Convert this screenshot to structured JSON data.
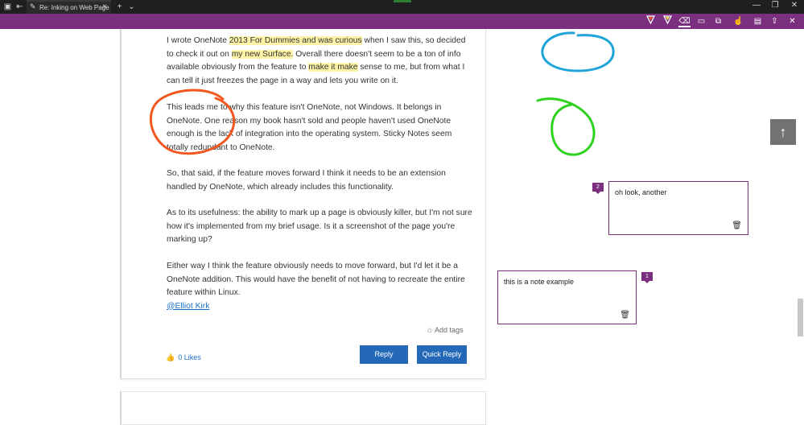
{
  "browser": {
    "tab_title": "Re: Inking on Web Page",
    "tab_icon": "pen-icon",
    "new_tab_symbol": "+",
    "tab_list_symbol": "⌄",
    "minimize_symbol": "—",
    "maximize_symbol": "❐",
    "close_symbol": "✕"
  },
  "ink_toolbar": {
    "tools": [
      "ballpoint-pen-icon",
      "highlighter-icon",
      "eraser-icon",
      "add-note-icon",
      "clip-icon",
      "touch-writing-icon",
      "save-icon",
      "share-icon",
      "exit-icon"
    ],
    "accent": "#7b2f7f"
  },
  "post": {
    "p1_a": "I wrote OneNote ",
    "p1_hl1": "2013 For Dummies and was curious",
    "p1_b": " when I saw this, so decided to check it out on ",
    "p1_hl2": "my new Surface.",
    "p1_c": " Overall there doesn't seem to be a ton of info available obviously from the feature to ",
    "p1_hl3": "make it make",
    "p1_d": " sense to me, but from what I can tell it just freezes the page in a way and lets you write on it.",
    "p2": "This leads me to why this feature isn't OneNote, not Windows. It belongs in OneNote. One reason my book hasn't sold and people haven't used OneNote enough is the lack of integration into the operating system. Sticky Notes seem totally redundant to OneNote.",
    "p3": "So, that said, if the feature moves forward I think it needs to be an extension handled by OneNote, which already includes this functionality.",
    "p4": "As to its usefulness: the ability to mark up a page is obviously killer, but I'm not sure how it's implemented from my brief usage. Is it a screenshot of the page you're marking up?",
    "p5": "Either way I think the feature obviously needs to move forward, but I'd let it be a OneNote addition. This would have the benefit of not having to recreate the entire feature within Linux.",
    "mention": "@Elliot Kirk",
    "add_tags": "Add tags",
    "likes": "0 Likes",
    "reply": "Reply",
    "quick_reply": "Quick Reply"
  },
  "notes": [
    {
      "number": "1",
      "text": "this is a note example"
    },
    {
      "number": "2",
      "text": "oh look, another"
    }
  ],
  "ink_colors": {
    "red": "#f1571f",
    "blue": "#1ea4d9",
    "green": "#2fd11f"
  }
}
